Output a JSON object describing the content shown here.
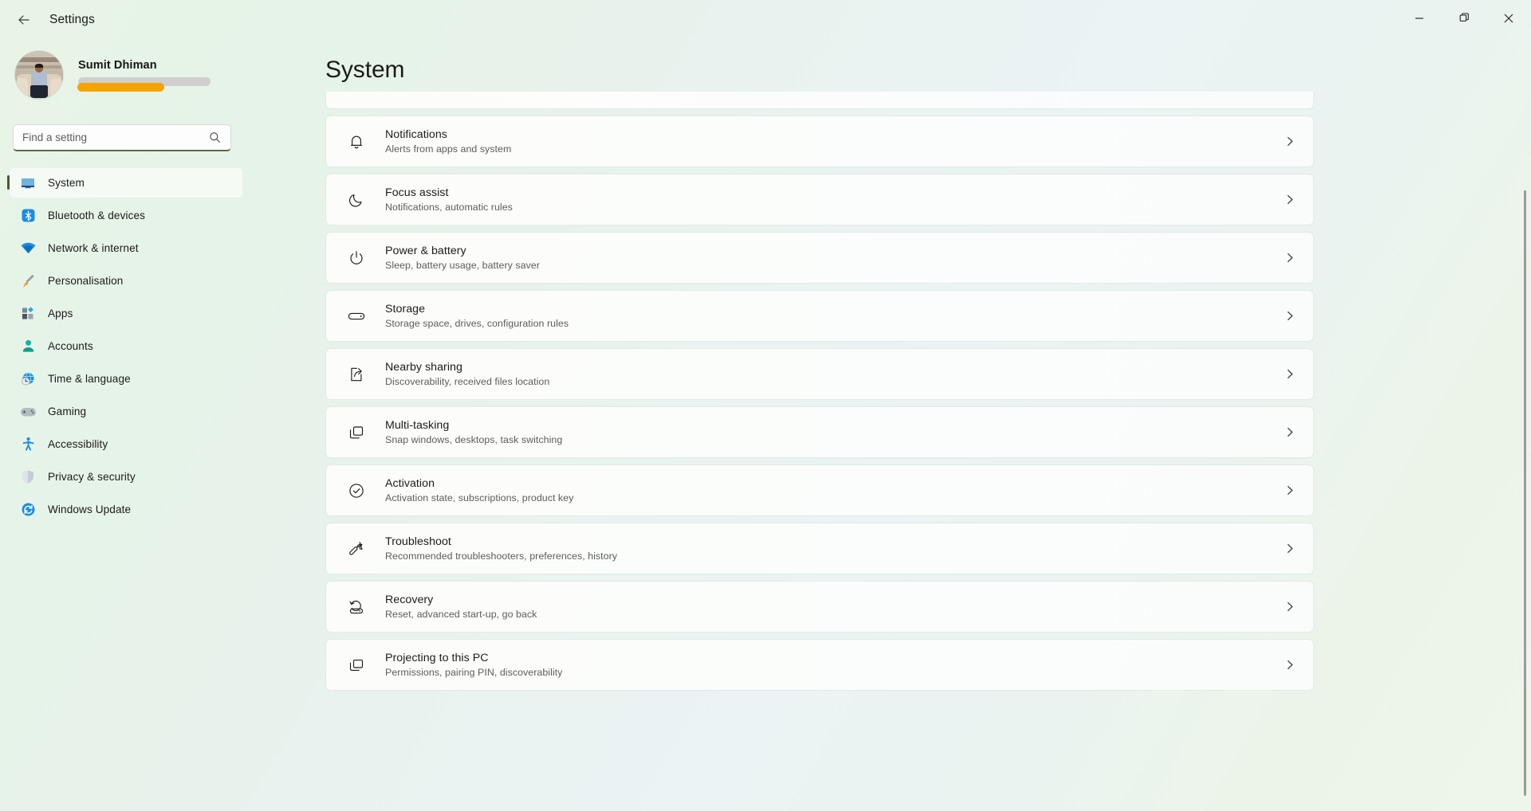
{
  "window": {
    "title": "Settings",
    "back_icon": "back-arrow-icon",
    "controls": {
      "minimize": "minimize-icon",
      "maximize": "maximize-icon",
      "close": "close-icon"
    }
  },
  "sidebar": {
    "profile": {
      "name": "Sumit Dhiman",
      "avatar": "user-avatar-photo",
      "redacted_gray": "",
      "redacted_orange": ""
    },
    "search": {
      "placeholder": "Find a setting",
      "value": "",
      "icon": "search-icon"
    },
    "items": [
      {
        "label": "System",
        "icon": "monitor-icon",
        "active": true
      },
      {
        "label": "Bluetooth & devices",
        "icon": "bluetooth-icon",
        "active": false
      },
      {
        "label": "Network & internet",
        "icon": "wifi-icon",
        "active": false
      },
      {
        "label": "Personalisation",
        "icon": "paintbrush-icon",
        "active": false
      },
      {
        "label": "Apps",
        "icon": "apps-grid-icon",
        "active": false
      },
      {
        "label": "Accounts",
        "icon": "person-icon",
        "active": false
      },
      {
        "label": "Time & language",
        "icon": "globe-clock-icon",
        "active": false
      },
      {
        "label": "Gaming",
        "icon": "gamepad-icon",
        "active": false
      },
      {
        "label": "Accessibility",
        "icon": "accessibility-icon",
        "active": false
      },
      {
        "label": "Privacy & security",
        "icon": "shield-icon",
        "active": false
      },
      {
        "label": "Windows Update",
        "icon": "update-refresh-icon",
        "active": false
      }
    ]
  },
  "main": {
    "title": "System",
    "chevron_icon": "chevron-right-icon",
    "cards": [
      {
        "title": "Notifications",
        "sub": "Alerts from apps and system",
        "icon": "bell-icon"
      },
      {
        "title": "Focus assist",
        "sub": "Notifications, automatic rules",
        "icon": "moon-icon"
      },
      {
        "title": "Power & battery",
        "sub": "Sleep, battery usage, battery saver",
        "icon": "power-icon"
      },
      {
        "title": "Storage",
        "sub": "Storage space, drives, configuration rules",
        "icon": "drive-icon"
      },
      {
        "title": "Nearby sharing",
        "sub": "Discoverability, received files location",
        "icon": "share-icon"
      },
      {
        "title": "Multi-tasking",
        "sub": "Snap windows, desktops, task switching",
        "icon": "windows-stack-icon"
      },
      {
        "title": "Activation",
        "sub": "Activation state, subscriptions, product key",
        "icon": "check-circle-icon"
      },
      {
        "title": "Troubleshoot",
        "sub": "Recommended troubleshooters, preferences, history",
        "icon": "wrench-icon"
      },
      {
        "title": "Recovery",
        "sub": "Reset, advanced start-up, go back",
        "icon": "recovery-icon"
      },
      {
        "title": "Projecting to this PC",
        "sub": "Permissions, pairing PIN, discoverability",
        "icon": "project-screen-icon"
      }
    ]
  },
  "colors": {
    "accent_bar": "#4a5a2c",
    "redact_orange": "#f5a300",
    "redact_gray": "#cfcfcf",
    "text_primary": "#1b1b1b",
    "text_secondary": "#5c5c5c"
  }
}
